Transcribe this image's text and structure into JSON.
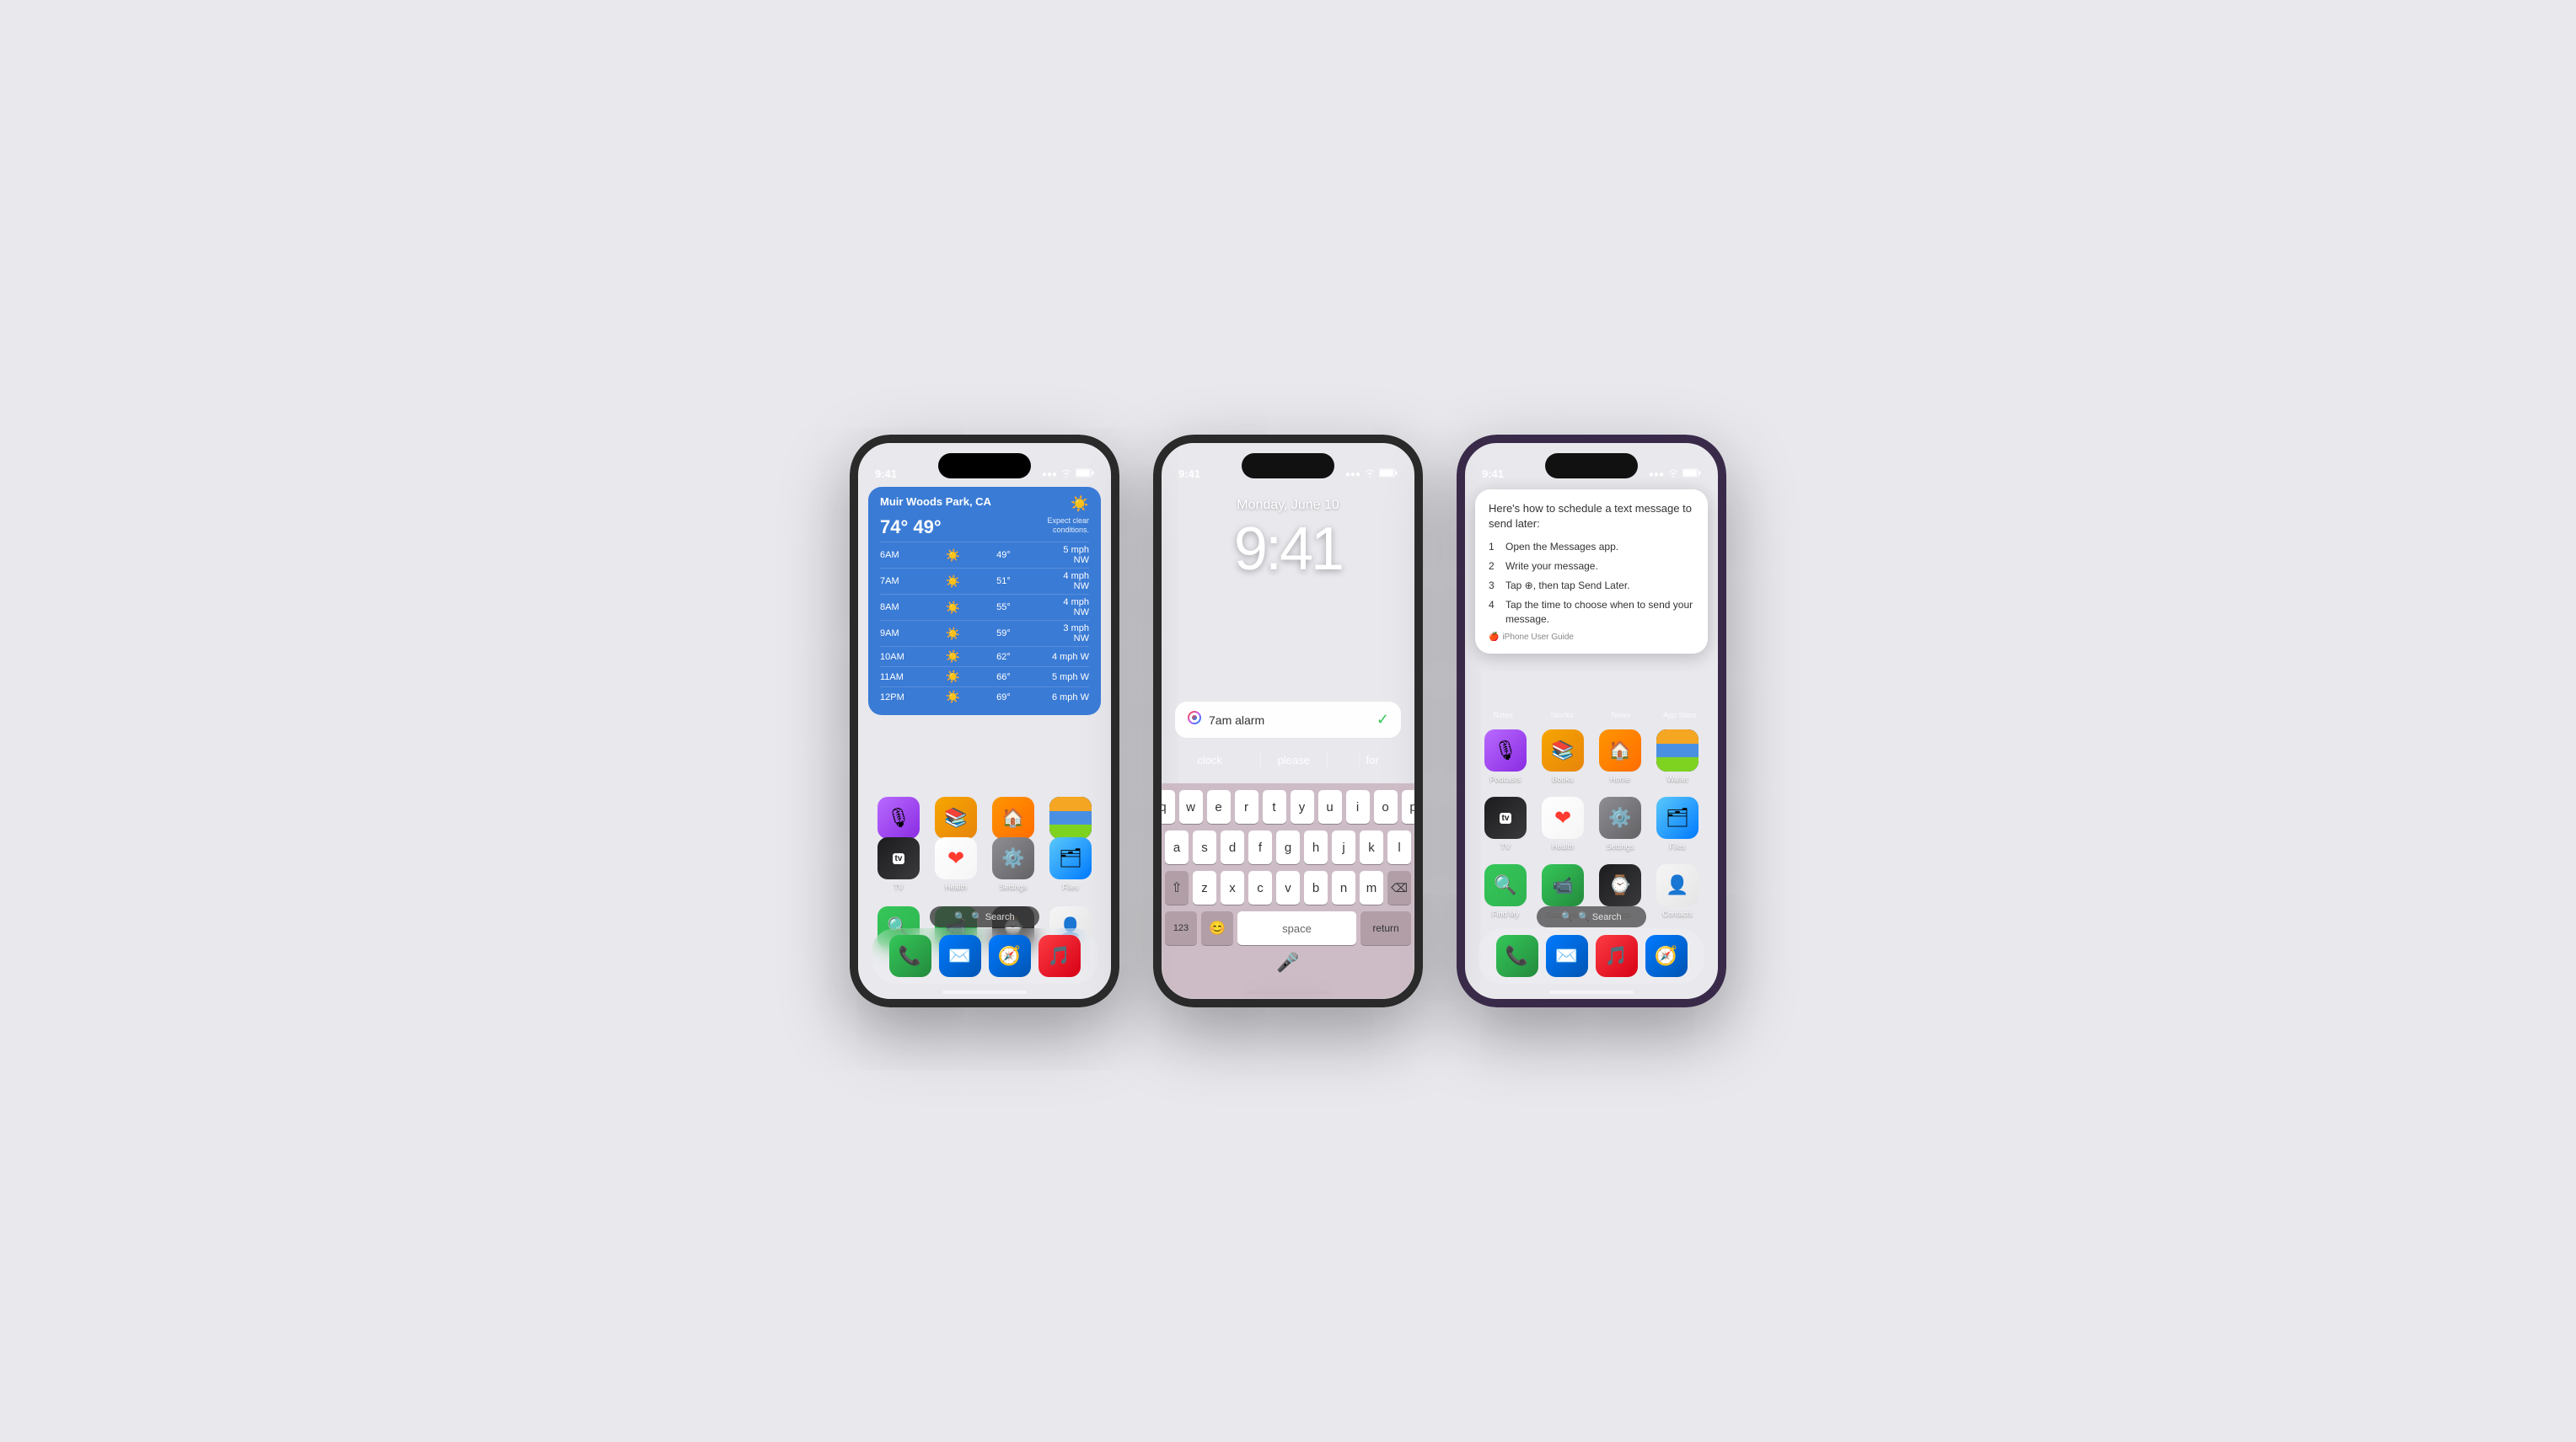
{
  "phone1": {
    "statusBar": {
      "time": "9:41",
      "signal": "●●●●",
      "wifi": "WiFi",
      "battery": "🔋"
    },
    "weather": {
      "location": "Muir Woods Park, CA",
      "sunIcon": "☀️",
      "temps": "74° 49°",
      "note": "Expect clear\nconditions.",
      "rows": [
        {
          "time": "6AM",
          "icon": "☀️",
          "temp": "49°",
          "wind": "5 mph NW"
        },
        {
          "time": "7AM",
          "icon": "☀️",
          "temp": "51°",
          "wind": "4 mph NW"
        },
        {
          "time": "8AM",
          "icon": "☀️",
          "temp": "55°",
          "wind": "4 mph NW"
        },
        {
          "time": "9AM",
          "icon": "☀️",
          "temp": "59°",
          "wind": "3 mph NW"
        },
        {
          "time": "10AM",
          "icon": "☀️",
          "temp": "62°",
          "wind": "4 mph W"
        },
        {
          "time": "11AM",
          "icon": "☀️",
          "temp": "66°",
          "wind": "5 mph W"
        },
        {
          "time": "12PM",
          "icon": "☀️",
          "temp": "69°",
          "wind": "6 mph W"
        }
      ]
    },
    "apps": {
      "row1": [
        "TV",
        "Health",
        "Settings",
        "Files"
      ],
      "row2": [
        "Find My",
        "FaceTime",
        "Watch",
        "Contacts"
      ]
    },
    "dock": [
      "Phone",
      "Mail",
      "Safari",
      "Music"
    ],
    "search": "🔍 Search"
  },
  "phone2": {
    "statusBar": {
      "time": "9:41",
      "signal": "signal",
      "wifi": "wifi",
      "battery": "battery"
    },
    "date": "Monday, June 10",
    "time": "9:41",
    "searchText": "7am alarm",
    "autocomplete": [
      "clock",
      "please",
      "for"
    ],
    "keyboard": {
      "row1": [
        "q",
        "w",
        "e",
        "r",
        "t",
        "y",
        "u",
        "i",
        "o",
        "p"
      ],
      "row2": [
        "a",
        "s",
        "d",
        "f",
        "g",
        "h",
        "j",
        "k",
        "l"
      ],
      "row3": [
        "z",
        "x",
        "c",
        "v",
        "b",
        "n",
        "m"
      ],
      "numLabel": "123",
      "spaceLabel": "space",
      "returnLabel": "return"
    }
  },
  "phone3": {
    "statusBar": {
      "time": "9:41",
      "signal": "signal",
      "wifi": "wifi",
      "battery": "battery"
    },
    "siri": {
      "title": "Here's how to schedule a text message to send later:",
      "steps": [
        "Open the Messages app.",
        "Write your message.",
        "Tap ⊕, then tap Send Later.",
        "Tap the time to choose when to send your message."
      ],
      "source": "iPhone User Guide"
    },
    "topApps": [
      "Notes",
      "Stocks",
      "News",
      "App Store"
    ],
    "apps": {
      "row1": [
        "Podcasts",
        "Books",
        "Home",
        "Wallet"
      ],
      "row2": [
        "TV",
        "Health",
        "Settings",
        "Files"
      ],
      "row3": [
        "Find My",
        "FaceTime",
        "Watch",
        "Contacts"
      ]
    },
    "dock": [
      "Phone",
      "Mail",
      "Music",
      "Safari"
    ],
    "search": "🔍 Search"
  }
}
